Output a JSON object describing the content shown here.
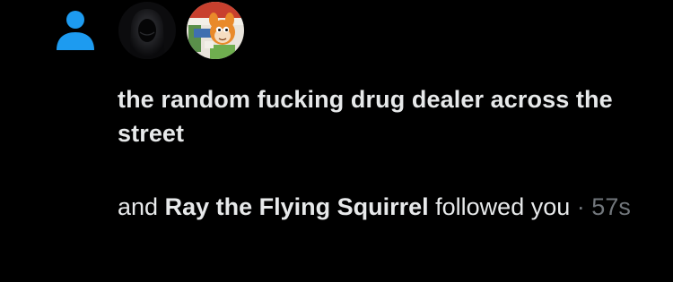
{
  "notification": {
    "icon": "person-icon",
    "accent_color": "#1d9bf0",
    "avatars": [
      {
        "icon": "hooded-figure-avatar"
      },
      {
        "icon": "cartoon-squirrel-avatar"
      }
    ],
    "first_user": "the random fucking drug dealer across the street",
    "connector": "and",
    "second_user": "Ray the Flying Squirrel",
    "action": "followed you",
    "separator": "·",
    "time": "57s"
  }
}
